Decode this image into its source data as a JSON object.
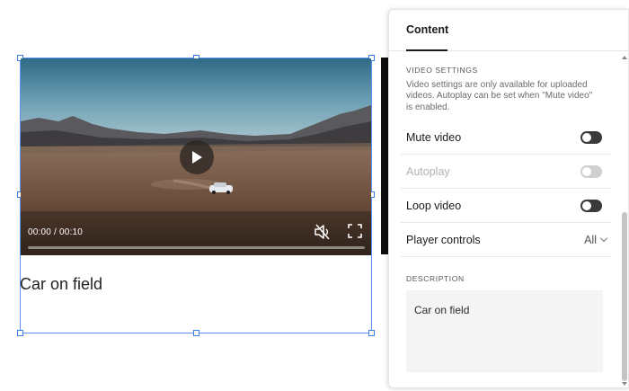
{
  "block": {
    "video": {
      "time": "00:00 / 00:10",
      "progress": 0
    },
    "caption": "Car on field"
  },
  "panel": {
    "tab": "Content",
    "video_settings": {
      "title": "VIDEO SETTINGS",
      "help": "Video settings are only available for uploaded videos. Autoplay can be set when \"Mute video\" is enabled.",
      "mute": {
        "label": "Mute video",
        "on": false
      },
      "autoplay": {
        "label": "Autoplay",
        "on": false,
        "disabled": true
      },
      "loop": {
        "label": "Loop video",
        "on": false
      },
      "player_controls": {
        "label": "Player controls",
        "value": "All"
      }
    },
    "description": {
      "title": "DESCRIPTION",
      "value": "Car on field"
    }
  },
  "colors": {
    "selection": "#5b93f0",
    "toggle_off": "#3a3a3a",
    "toggle_disabled": "#cfcfcf"
  },
  "icons": [
    "play-icon",
    "muted-speaker-icon",
    "fullscreen-icon",
    "chevron-down-icon",
    "scroll-up-icon",
    "scroll-down-icon"
  ]
}
